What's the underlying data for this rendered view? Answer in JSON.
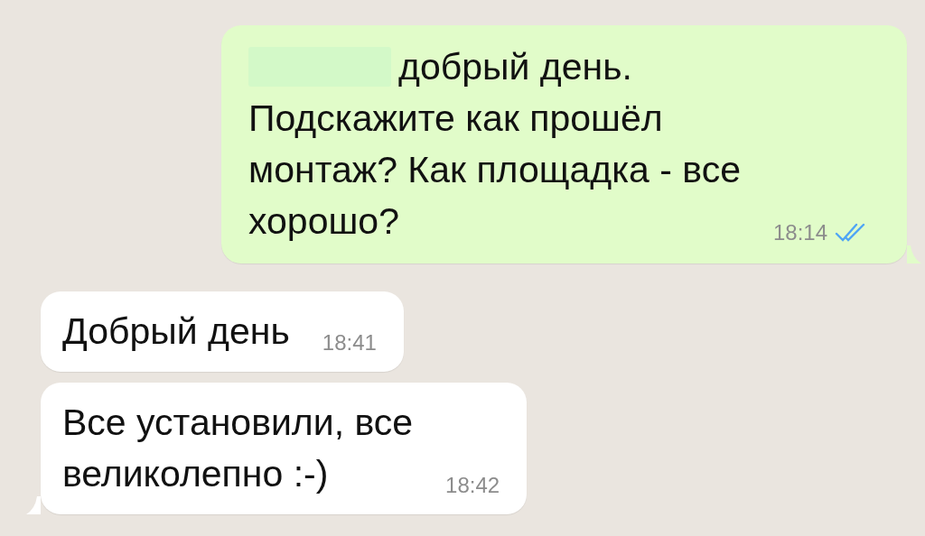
{
  "messages": [
    {
      "kind": "outgoing",
      "redacted": true,
      "text": "добрый день.\nПодскажите как прошёл\nмонтаж? Как площадка - все\nхорошо?",
      "time": "18:14",
      "read": true,
      "tail": true
    },
    {
      "kind": "incoming",
      "redacted": false,
      "text": "Добрый день",
      "time": "18:41",
      "tail": false
    },
    {
      "kind": "incoming",
      "redacted": false,
      "text": "Все установили, все\nвеликолепно :-)",
      "time": "18:42",
      "tail": true
    }
  ]
}
